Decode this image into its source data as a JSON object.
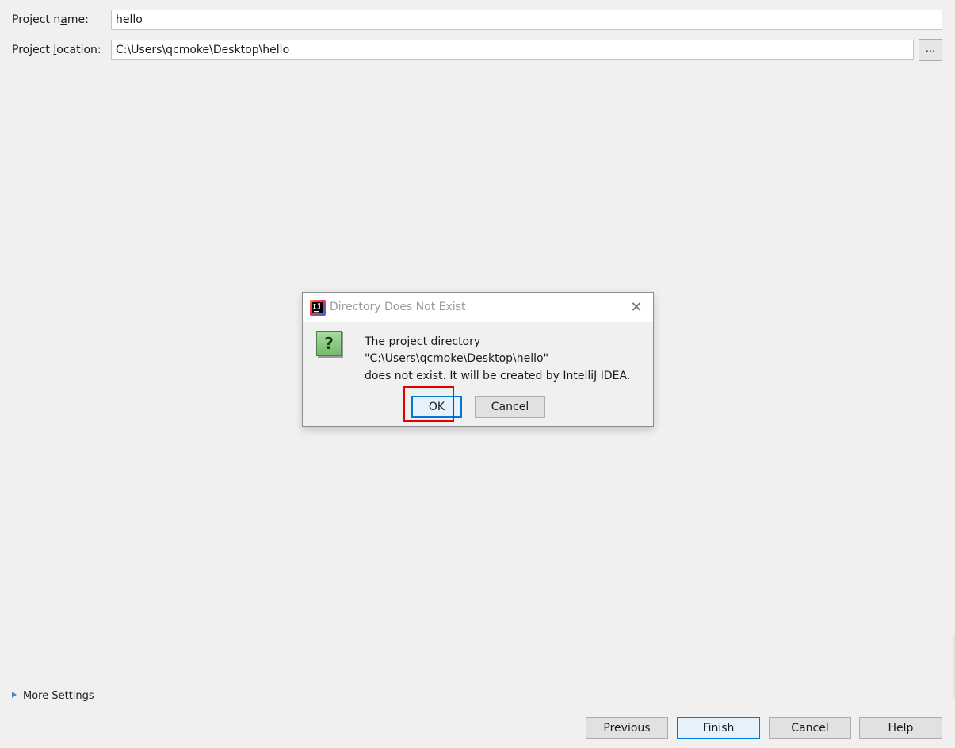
{
  "form": {
    "project_name": {
      "label_pre": "Project n",
      "label_mnemonic": "a",
      "label_post": "me:",
      "value": "hello"
    },
    "project_location": {
      "label_pre": "Project ",
      "label_mnemonic": "l",
      "label_post": "ocation:",
      "value": "C:\\Users\\qcmoke\\Desktop\\hello",
      "browse_label": "..."
    }
  },
  "dialog": {
    "title": "Directory Does Not Exist",
    "close_glyph": "✕",
    "icon_glyph": "?",
    "message_lines": [
      "The project directory",
      "\"C:\\Users\\qcmoke\\Desktop\\hello\"",
      "does not exist. It will be created by IntelliJ IDEA."
    ],
    "ok_label": "OK",
    "cancel_label": "Cancel"
  },
  "more_settings": {
    "label_pre": "Mor",
    "label_mnemonic": "e",
    "label_post": " Settings"
  },
  "buttons": {
    "previous": "Previous",
    "finish": "Finish",
    "cancel": "Cancel",
    "help": "Help"
  },
  "icons": {
    "app": "intellij-idea-icon",
    "question": "question-icon",
    "close": "close-icon",
    "expand": "triangle-right-icon"
  },
  "colors": {
    "accent": "#0078d7",
    "highlight": "#e00000",
    "background": "#f0f0f0"
  }
}
